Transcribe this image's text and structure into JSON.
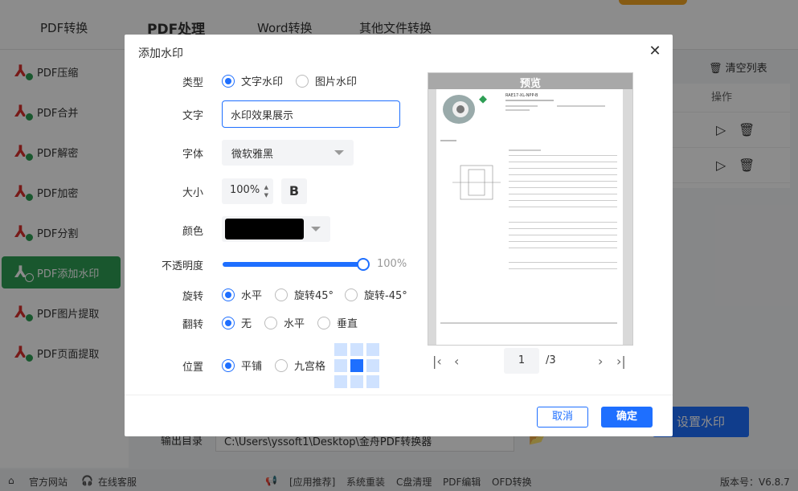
{
  "app": {
    "tabs": [
      "PDF转换",
      "PDF处理",
      "Word转换",
      "其他文件转换"
    ],
    "active_tab": "PDF处理",
    "sidebar": [
      "PDF压缩",
      "PDF合并",
      "PDF解密",
      "PDF加密",
      "PDF分割",
      "PDF添加水印",
      "PDF图片提取",
      "PDF页面提取"
    ],
    "active_sidebar": "PDF添加水印",
    "clear_list": "清空列表",
    "table_header_ops": "操作",
    "output_dir_label": "输出目录",
    "output_dir_path": "C:\\Users\\yssoft1\\Desktop\\金舟PDF转换器",
    "set_watermark_button": "设置水印",
    "status": {
      "website": "官方网站",
      "service": "在线客服",
      "recommend": "[应用推荐]",
      "links": [
        "系统重装",
        "C盘清理",
        "PDF编辑",
        "OFD转换"
      ],
      "version": "版本号：V6.8.7"
    }
  },
  "dialog": {
    "title": "添加水印",
    "type_label": "类型",
    "type_options": [
      "文字水印",
      "图片水印"
    ],
    "type_selected": "文字水印",
    "text_label": "文字",
    "text_value": "水印效果展示",
    "font_label": "字体",
    "font_value": "微软雅黑",
    "size_label": "大小",
    "size_value": "100%",
    "bold_label": "B",
    "color_label": "颜色",
    "color_value": "#000000",
    "opacity_label": "不透明度",
    "opacity_value": "100%",
    "opacity_level": 1.0,
    "rotate_label": "旋转",
    "rotate_options": [
      "水平",
      "旋转45°",
      "旋转-45°"
    ],
    "rotate_selected": "水平",
    "flip_label": "翻转",
    "flip_options": [
      "无",
      "水平",
      "垂直"
    ],
    "flip_selected": "无",
    "position_label": "位置",
    "position_options": [
      "平铺",
      "九宫格"
    ],
    "position_selected": "平铺",
    "grid_selected_cell": 4,
    "preview_title": "预览",
    "preview_doc_title": "RAE17-XL-NPP-B",
    "current_page": "1",
    "total_pages": "/3",
    "cancel_button": "取消",
    "ok_button": "确定"
  },
  "colors": {
    "primary": "#1e6fff",
    "sidebar_active": "#2e9e55",
    "pdf_red": "#d9302c"
  }
}
